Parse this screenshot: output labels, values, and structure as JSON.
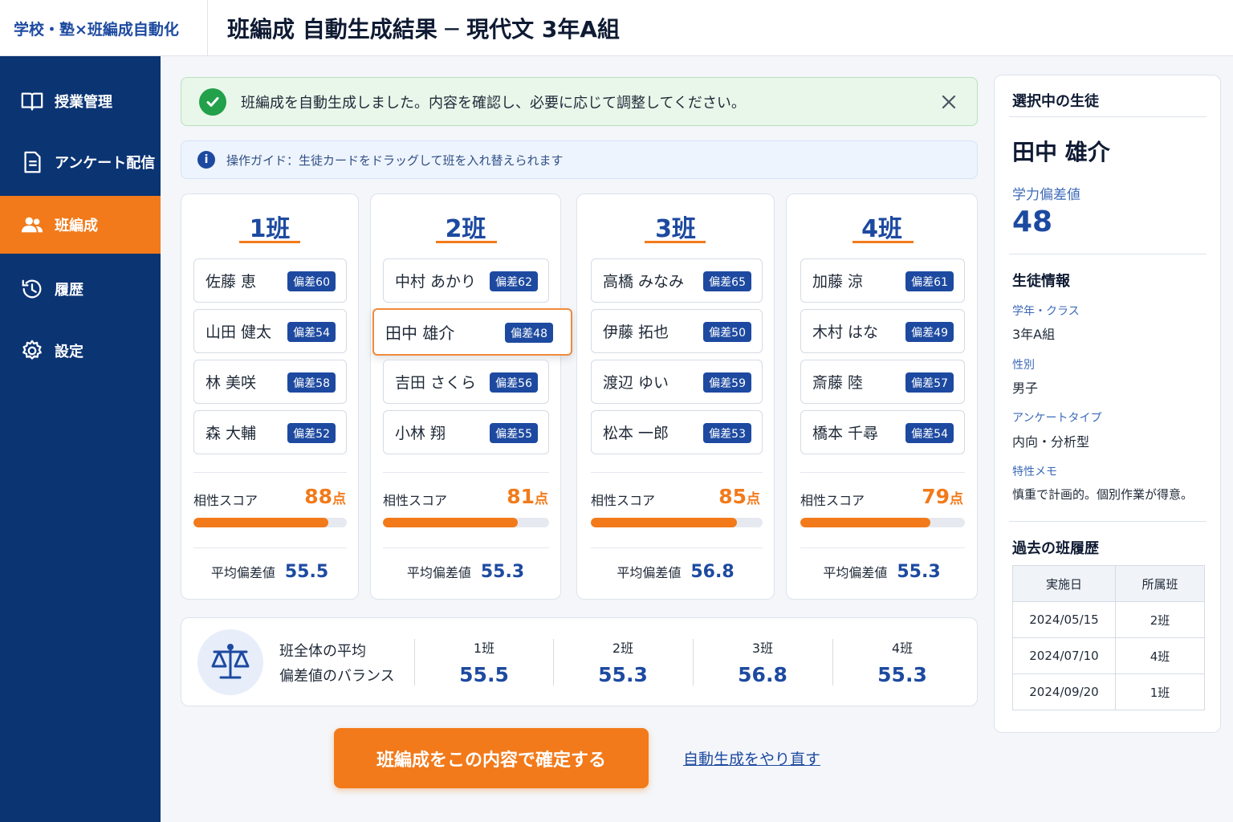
{
  "app": {
    "brand": "学校・塾×班編成自動化",
    "page_title": "班編成 自動生成結果 ─ 現代文 3年A組"
  },
  "sidebar": {
    "items": [
      {
        "label": "授業管理",
        "icon": "book-icon",
        "active": false
      },
      {
        "label": "アンケート配信",
        "icon": "document-icon",
        "active": false
      },
      {
        "label": "班編成",
        "icon": "users-icon",
        "active": true
      },
      {
        "label": "履歴",
        "icon": "history-icon",
        "active": false
      },
      {
        "label": "設定",
        "icon": "gear-icon",
        "active": false
      }
    ]
  },
  "alerts": {
    "success": "班編成を自動生成しました。内容を確認し、必要に応じて調整してください。",
    "guide": "操作ガイド：生徒カードをドラッグして班を入れ替えられます"
  },
  "groups": [
    {
      "title": "1班",
      "students": [
        {
          "name": "佐藤 恵",
          "badge": "偏差60"
        },
        {
          "name": "山田 健太",
          "badge": "偏差54"
        },
        {
          "name": "林 美咲",
          "badge": "偏差58"
        },
        {
          "name": "森 大輔",
          "badge": "偏差52"
        }
      ],
      "score_label": "相性スコア",
      "score": "88",
      "score_unit": "点",
      "score_ratio": 0.88,
      "avg_label": "平均偏差値",
      "avg": "55.5"
    },
    {
      "title": "2班",
      "students": [
        {
          "name": "中村 あかり",
          "badge": "偏差62"
        },
        {
          "name": "田中 雄介",
          "badge": "偏差48",
          "selected": true
        },
        {
          "name": "吉田 さくら",
          "badge": "偏差56"
        },
        {
          "name": "小林 翔",
          "badge": "偏差55"
        }
      ],
      "score_label": "相性スコア",
      "score": "81",
      "score_unit": "点",
      "score_ratio": 0.81,
      "avg_label": "平均偏差値",
      "avg": "55.3"
    },
    {
      "title": "3班",
      "students": [
        {
          "name": "高橋 みなみ",
          "badge": "偏差65"
        },
        {
          "name": "伊藤 拓也",
          "badge": "偏差50"
        },
        {
          "name": "渡辺 ゆい",
          "badge": "偏差59"
        },
        {
          "name": "松本 一郎",
          "badge": "偏差53"
        }
      ],
      "score_label": "相性スコア",
      "score": "85",
      "score_unit": "点",
      "score_ratio": 0.85,
      "avg_label": "平均偏差値",
      "avg": "56.8"
    },
    {
      "title": "4班",
      "students": [
        {
          "name": "加藤 涼",
          "badge": "偏差61"
        },
        {
          "name": "木村 はな",
          "badge": "偏差49"
        },
        {
          "name": "斎藤 陸",
          "badge": "偏差57"
        },
        {
          "name": "橋本 千尋",
          "badge": "偏差54"
        }
      ],
      "score_label": "相性スコア",
      "score": "79",
      "score_unit": "点",
      "score_ratio": 0.79,
      "avg_label": "平均偏差値",
      "avg": "55.3"
    }
  ],
  "balance": {
    "label_line1": "班全体の平均",
    "label_line2": "偏差値のバランス",
    "items": [
      {
        "name": "1班",
        "value": "55.5"
      },
      {
        "name": "2班",
        "value": "55.3"
      },
      {
        "name": "3班",
        "value": "56.8"
      },
      {
        "name": "4班",
        "value": "55.3"
      }
    ]
  },
  "actions": {
    "confirm": "班編成をこの内容で確定する",
    "regenerate": "自動生成をやり直す"
  },
  "detail": {
    "heading": "選択中の生徒",
    "name": "田中 雄介",
    "score_label": "学力偏差値",
    "score": "48",
    "info_heading": "生徒情報",
    "grade_label": "学年・クラス",
    "grade": "3年A組",
    "gender_label": "性別",
    "gender": "男子",
    "survey_label": "アンケートタイプ",
    "survey": "内向・分析型",
    "memo_label": "特性メモ",
    "memo": "慎重で計画的。個別作業が得意。",
    "history_heading": "過去の班履歴",
    "history_headers": [
      "実施日",
      "所属班"
    ],
    "history": [
      {
        "date": "2024/05/15",
        "group": "2班"
      },
      {
        "date": "2024/07/10",
        "group": "4班"
      },
      {
        "date": "2024/09/20",
        "group": "1班"
      }
    ]
  },
  "colors": {
    "primary": "#1d4aa0",
    "sidebar": "#0b3473",
    "accent": "#f27a1a",
    "success": "#22a04a"
  }
}
